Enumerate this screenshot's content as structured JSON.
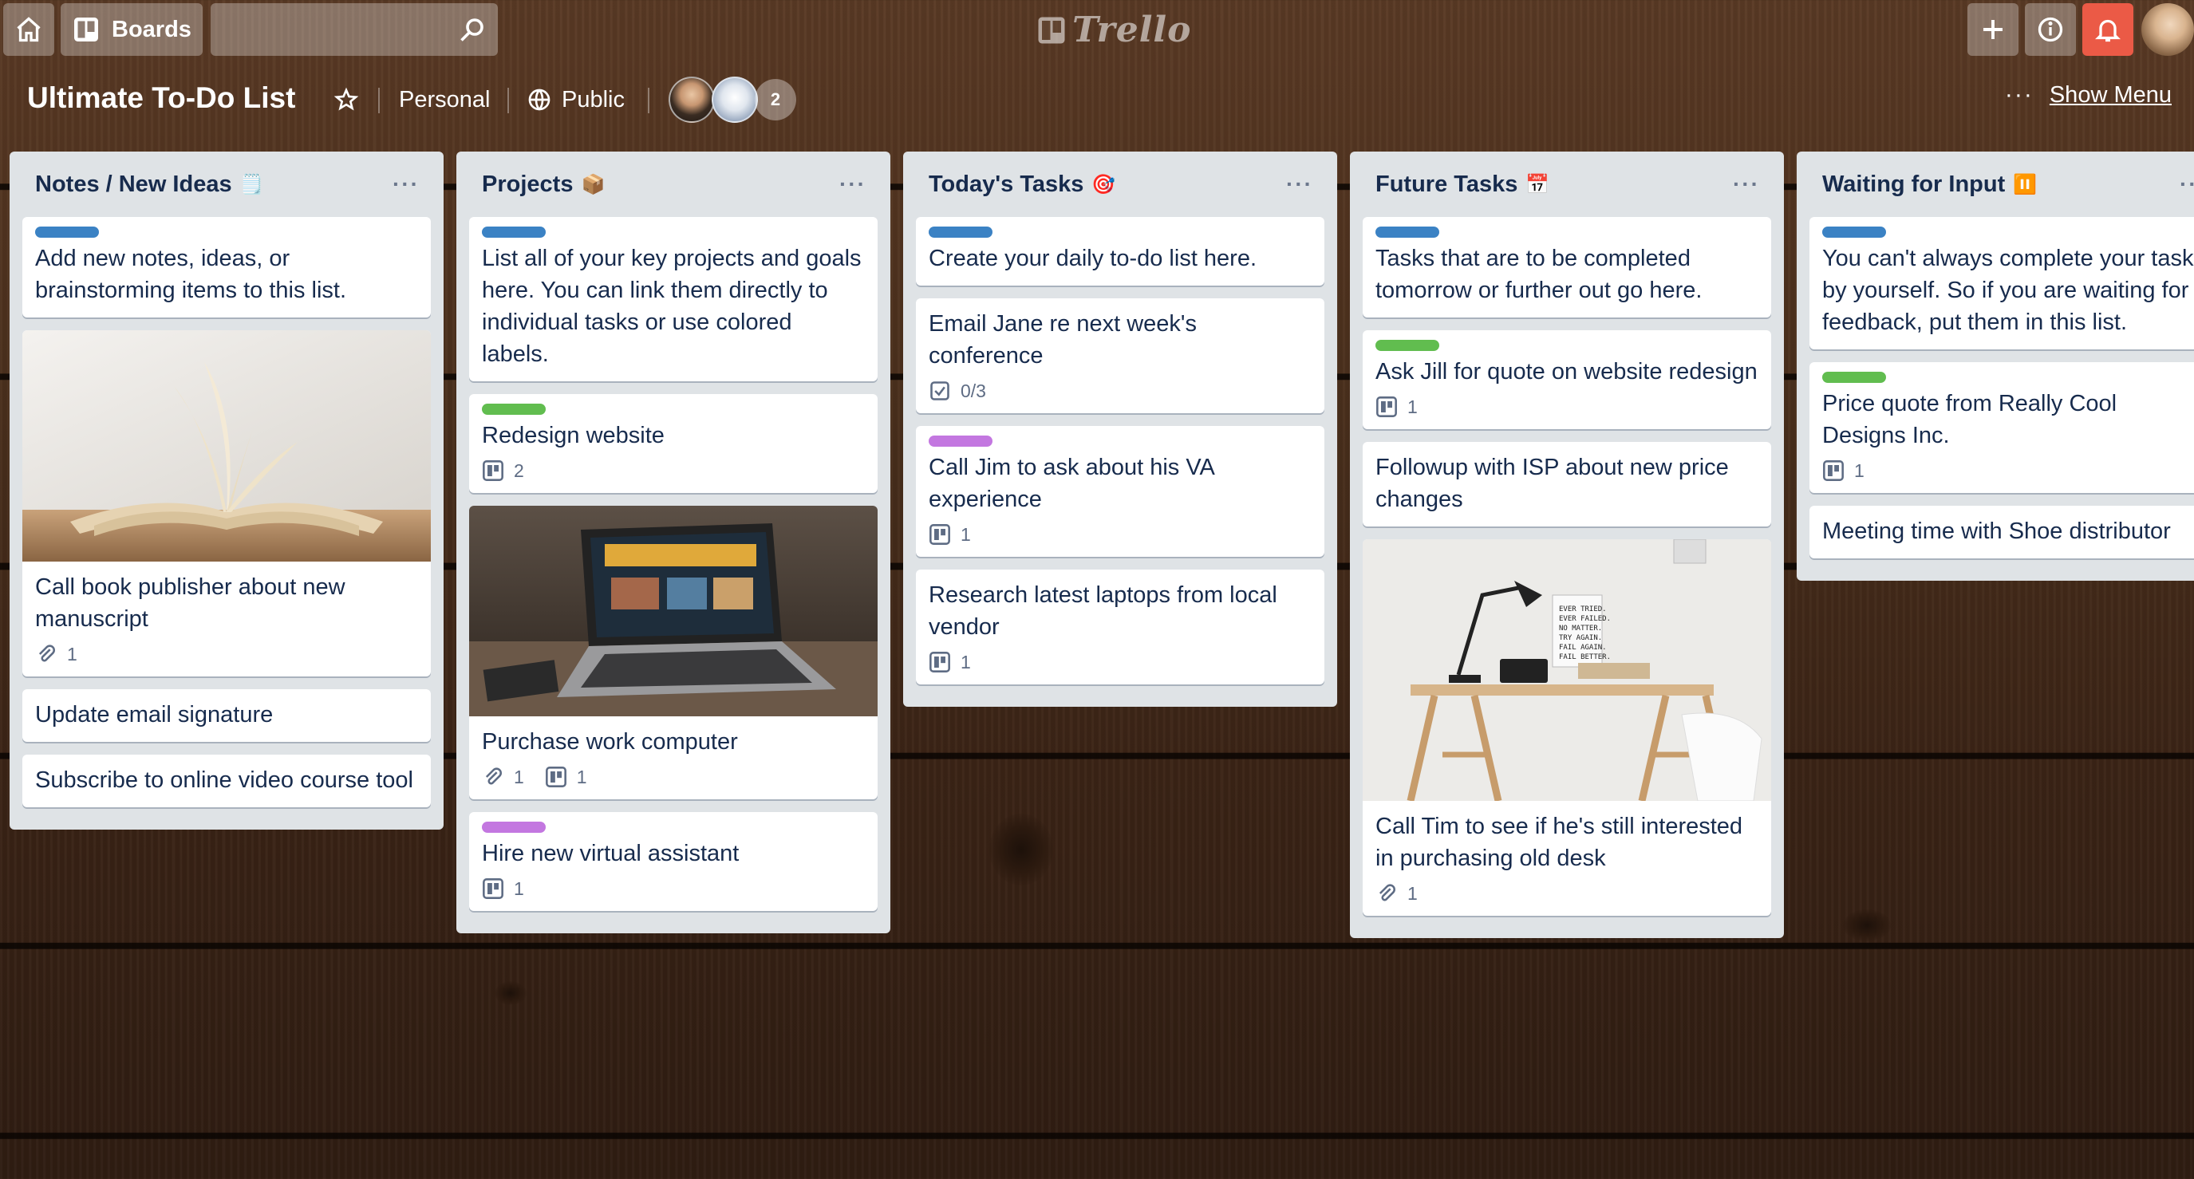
{
  "topbar": {
    "boards_label": "Boards",
    "search_value": "",
    "logo_text": "Trello"
  },
  "board": {
    "title": "Ultimate To-Do List",
    "visibility_team": "Personal",
    "visibility": "Public",
    "extra_members_count": "2",
    "show_menu_label": "Show Menu",
    "show_menu_dots": "···"
  },
  "colors": {
    "label_blue": "#3b82c4",
    "label_green": "#61bd4f",
    "label_purple": "#c377e0",
    "list_bg": "#dfe3e6",
    "notification_red": "#eb5a46"
  },
  "lists": [
    {
      "title": "Notes / New Ideas",
      "emoji": "🗒️",
      "menu": "···",
      "cards": [
        {
          "label": "blue",
          "title": "Add new notes, ideas, or brainstorming items to this list."
        },
        {
          "cover": "open-book",
          "title": "Call book publisher about new manuscript",
          "attachments": "1"
        },
        {
          "title": "Update email signature"
        },
        {
          "title": "Subscribe to online video course tool"
        }
      ]
    },
    {
      "title": "Projects",
      "emoji": "📦",
      "menu": "···",
      "cards": [
        {
          "label": "blue",
          "title": "List all of your key projects and goals here. You can link them directly to individual tasks or use colored labels."
        },
        {
          "label": "green",
          "title": "Redesign website",
          "trello_links": "2"
        },
        {
          "cover": "laptop",
          "title": "Purchase work computer",
          "attachments": "1",
          "trello_links": "1"
        },
        {
          "label": "purple",
          "title": "Hire new virtual assistant",
          "trello_links": "1"
        }
      ]
    },
    {
      "title": "Today's Tasks",
      "emoji": "🎯",
      "menu": "···",
      "cards": [
        {
          "label": "blue",
          "title": "Create your daily to-do list here."
        },
        {
          "title": "Email Jane re next week's conference",
          "checklist": "0/3"
        },
        {
          "label": "purple",
          "title": "Call Jim to ask about his VA experience",
          "trello_links": "1"
        },
        {
          "title": "Research latest laptops from local vendor",
          "trello_links": "1"
        }
      ]
    },
    {
      "title": "Future Tasks",
      "emoji": "📅",
      "menu": "···",
      "cards": [
        {
          "label": "blue",
          "title": "Tasks that are to be completed tomorrow or further out go here."
        },
        {
          "label": "green",
          "title": "Ask Jill for quote on website redesign",
          "trello_links": "1"
        },
        {
          "title": "Followup with ISP about new price changes"
        },
        {
          "cover": "desk",
          "title": "Call Tim to see if he's still interested in purchasing old desk",
          "attachments": "1"
        }
      ]
    },
    {
      "title": "Waiting for Input",
      "emoji": "⏸️",
      "menu": "···",
      "cards": [
        {
          "label": "blue",
          "title": "You can't always complete your tasks by yourself. So if you are waiting for feedback, put them in this list."
        },
        {
          "label": "green",
          "title": "Price quote from Really Cool Designs Inc.",
          "trello_links": "1"
        },
        {
          "title": "Meeting time with Shoe distributor"
        }
      ]
    }
  ]
}
